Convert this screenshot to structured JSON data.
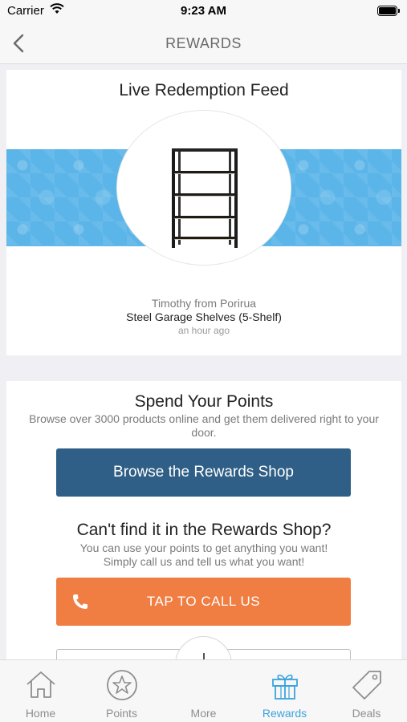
{
  "status_bar": {
    "carrier": "Carrier",
    "time": "9:23 AM"
  },
  "nav": {
    "title": "REWARDS",
    "back_icon": "chevron-left-icon"
  },
  "feed": {
    "title": "Live Redemption Feed",
    "user": "Timothy from Porirua",
    "item": "Steel Garage Shelves (5-Shelf)",
    "time_ago": "an hour ago",
    "banner_color": "#5bb5e8"
  },
  "spend": {
    "title": "Spend Your Points",
    "description": "Browse over 3000 products online and get them delivered right to your door.",
    "browse_button": "Browse the Rewards Shop",
    "browse_color": "#2f5f86",
    "cant_find_title": "Can't find it in the Rewards Shop?",
    "cant_find_line1": "You can use your points to get anything you want!",
    "cant_find_line2": "Simply call us and tell us what you want!",
    "call_button": "TAP TO CALL US",
    "call_color": "#f07d42"
  },
  "tabs": [
    {
      "label": "Home",
      "icon": "home-icon",
      "active": false
    },
    {
      "label": "Points",
      "icon": "star-icon",
      "active": false
    },
    {
      "label": "More",
      "icon": "plus-icon",
      "active": false
    },
    {
      "label": "Rewards",
      "icon": "gift-icon",
      "active": true
    },
    {
      "label": "Deals",
      "icon": "tag-icon",
      "active": false
    }
  ],
  "colors": {
    "tab_active": "#3ba3dc",
    "tab_inactive": "#8e8e8e"
  }
}
